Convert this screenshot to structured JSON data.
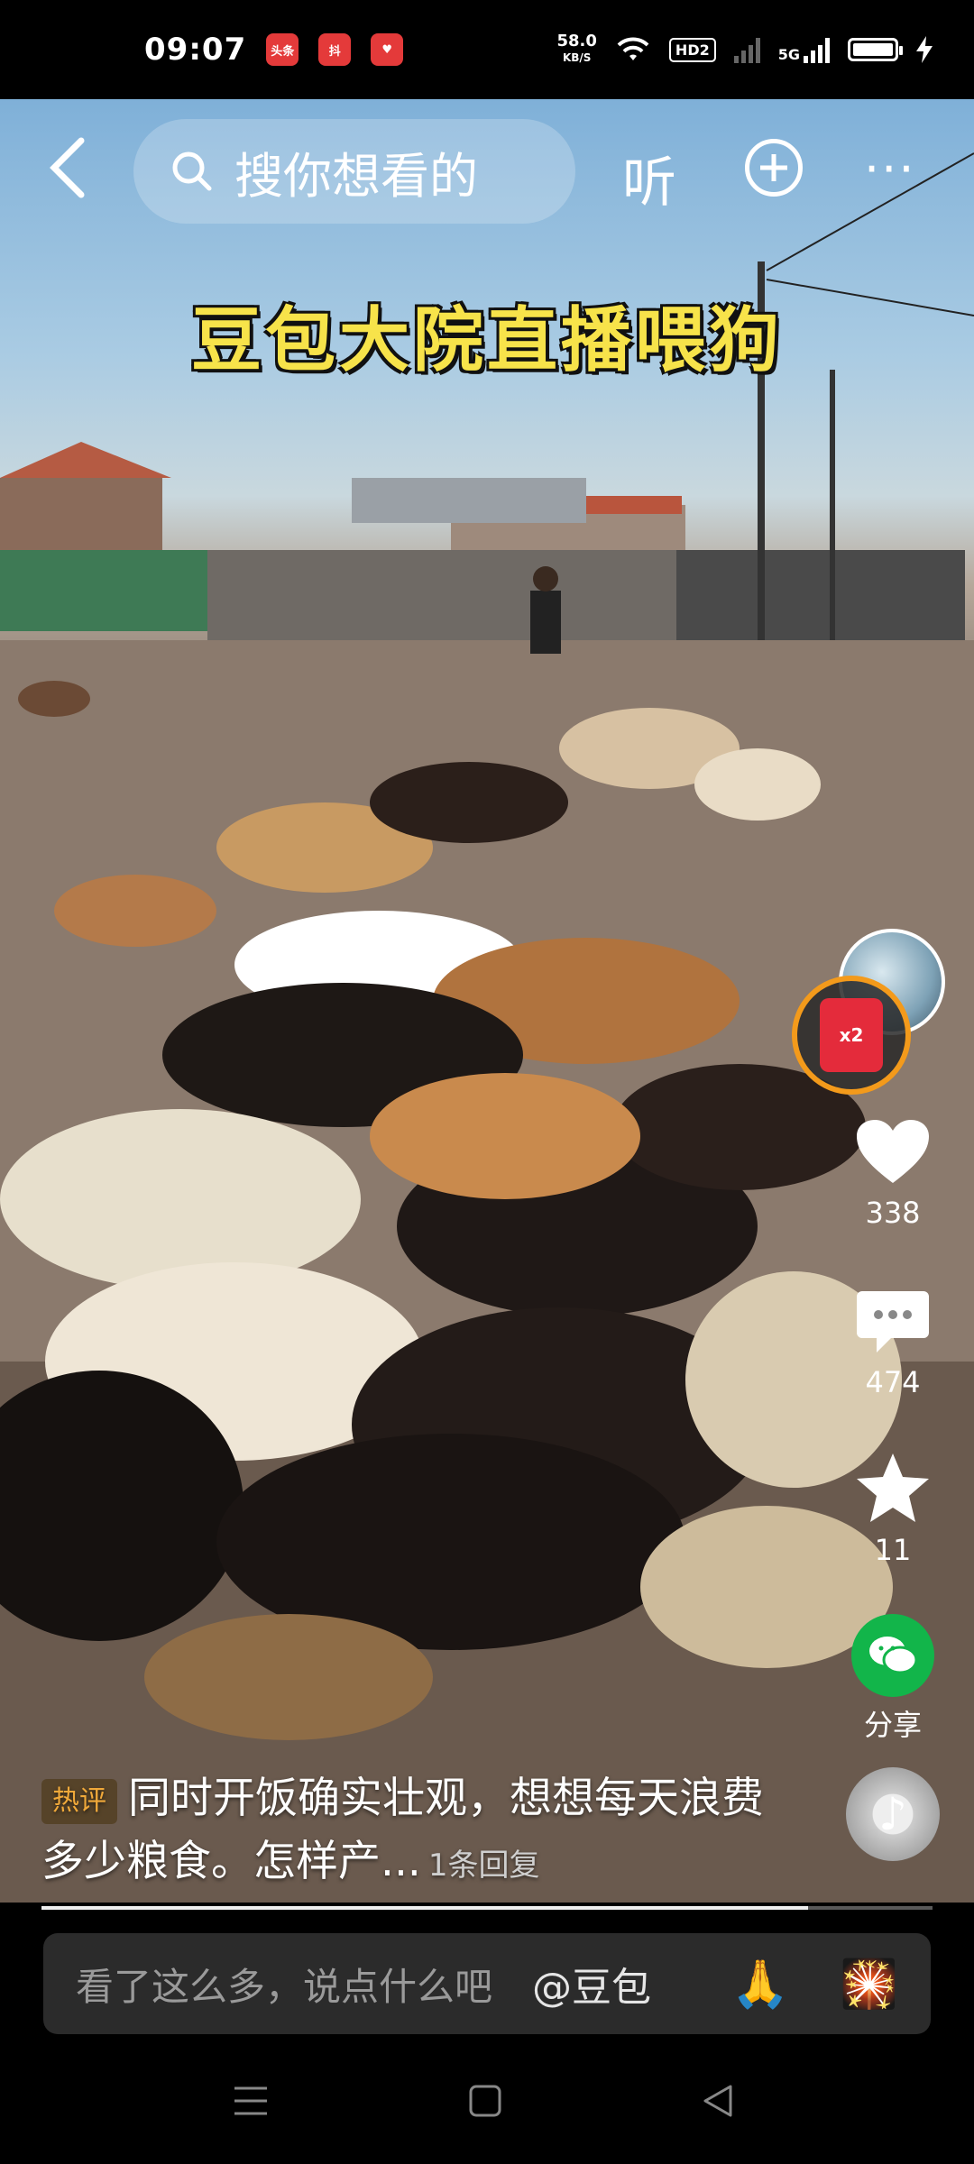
{
  "status_bar": {
    "time": "09:07",
    "apps": [
      "头条",
      "抖",
      "♥"
    ],
    "net_speed_value": "58.0",
    "net_speed_unit": "KB/S",
    "hd_label": "HD2",
    "network_label": "5G"
  },
  "top_bar": {
    "search_placeholder": "搜你想看的",
    "listen_label": "听",
    "more_label": "···"
  },
  "video": {
    "title_overlay": "豆包大院直播喂狗"
  },
  "side_actions": {
    "redpack_label": "x2",
    "like_count": "338",
    "comment_count": "474",
    "favorite_count": "11",
    "share_label": "分享"
  },
  "hot_comment": {
    "tag": "热评",
    "text": "同时开饭确实壮观，想想每天浪费多少粮食。怎样产...",
    "reply_count": "1条回复"
  },
  "progress": {
    "fraction": 0.86
  },
  "comment_bar": {
    "placeholder": "看了这么多，说点什么吧",
    "mention": "@豆包",
    "emoji_1": "🙏",
    "emoji_2": "🎇"
  },
  "colors": {
    "title_yellow": "#f7e34a",
    "share_green": "#12b54a",
    "hot_tag_orange": "#f0a93a",
    "redpack_red": "#e42b3b"
  }
}
